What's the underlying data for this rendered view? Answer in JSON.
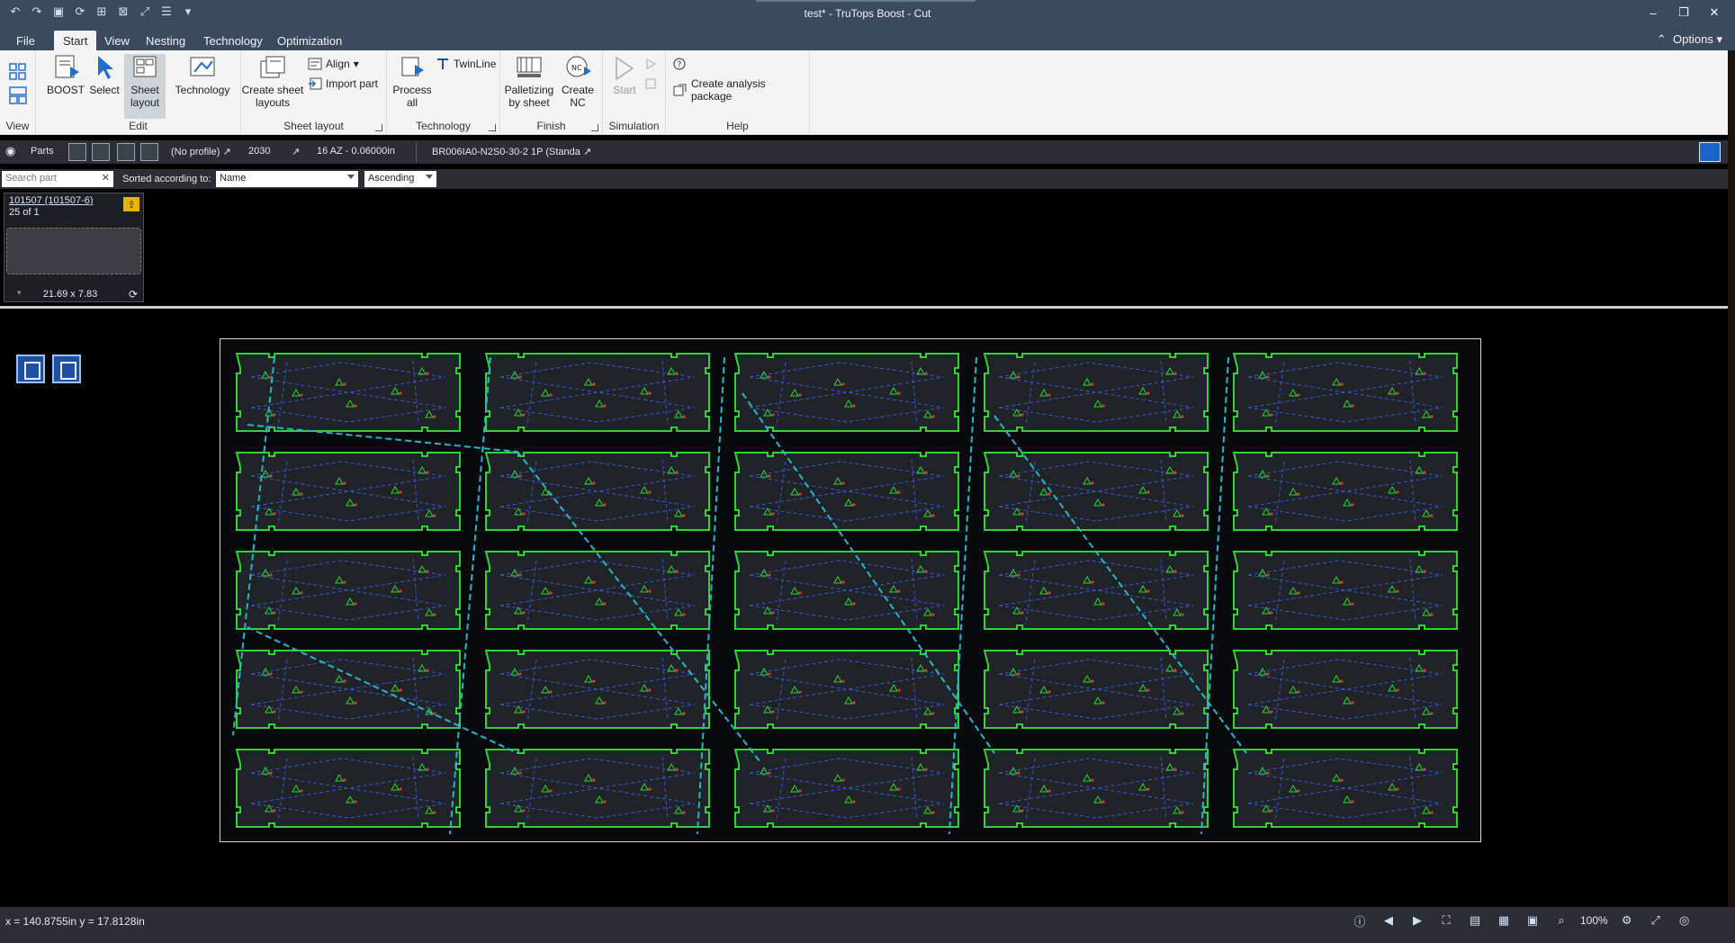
{
  "window": {
    "title": "test* - TruTops Boost - Cut"
  },
  "menu": {
    "tabs": [
      {
        "label": "File"
      },
      {
        "label": "Start"
      },
      {
        "label": "View"
      },
      {
        "label": "Nesting"
      },
      {
        "label": "Technology"
      },
      {
        "label": "Optimization"
      }
    ],
    "options_label": "Options"
  },
  "ribbon": {
    "groups": {
      "view": "View",
      "edit": "Edit",
      "sheet_layout": "Sheet layout",
      "technology": "Technology",
      "finish": "Finish",
      "simulation": "Simulation",
      "help": "Help"
    },
    "buttons": {
      "boost": "BOOST",
      "select": "Select",
      "sheet_layout_1": "Sheet",
      "sheet_layout_2": "layout",
      "technology": "Technology",
      "create_sheet_1": "Create sheet",
      "create_sheet_2": "layouts",
      "align": "Align",
      "import_part": "Import part",
      "process_all_1": "Process",
      "process_all_2": "all",
      "twinline": "TwinLine",
      "palletizing_1": "Palletizing",
      "palletizing_2": "by sheet",
      "create_nc_1": "Create",
      "create_nc_2": "NC",
      "start": "Start",
      "create_analysis": "Create analysis package"
    }
  },
  "context": {
    "parts_label": "Parts",
    "profile": "(No profile)",
    "material": "2030",
    "thickness": "16 AZ - 0.06000in",
    "machine": "BR006IA0-N2S0-30-2 1P (Standa"
  },
  "sortbar": {
    "search_placeholder": "Search part",
    "sorted_label": "Sorted according to:",
    "sort_field": "Name",
    "sort_order": "Ascending"
  },
  "part": {
    "name": "101507 (101507-6)",
    "quantity": "25 of 1",
    "dims": "21.69 x 7.83"
  },
  "status": {
    "coords": "x =  140.8755in  y =  17.8128in",
    "zoom": "100%"
  },
  "colors": {
    "part_outline": "#2fd52f",
    "rapid_path": "#27b6c9",
    "inner_path": "#3b56d6",
    "marker": "#d43b3b"
  }
}
